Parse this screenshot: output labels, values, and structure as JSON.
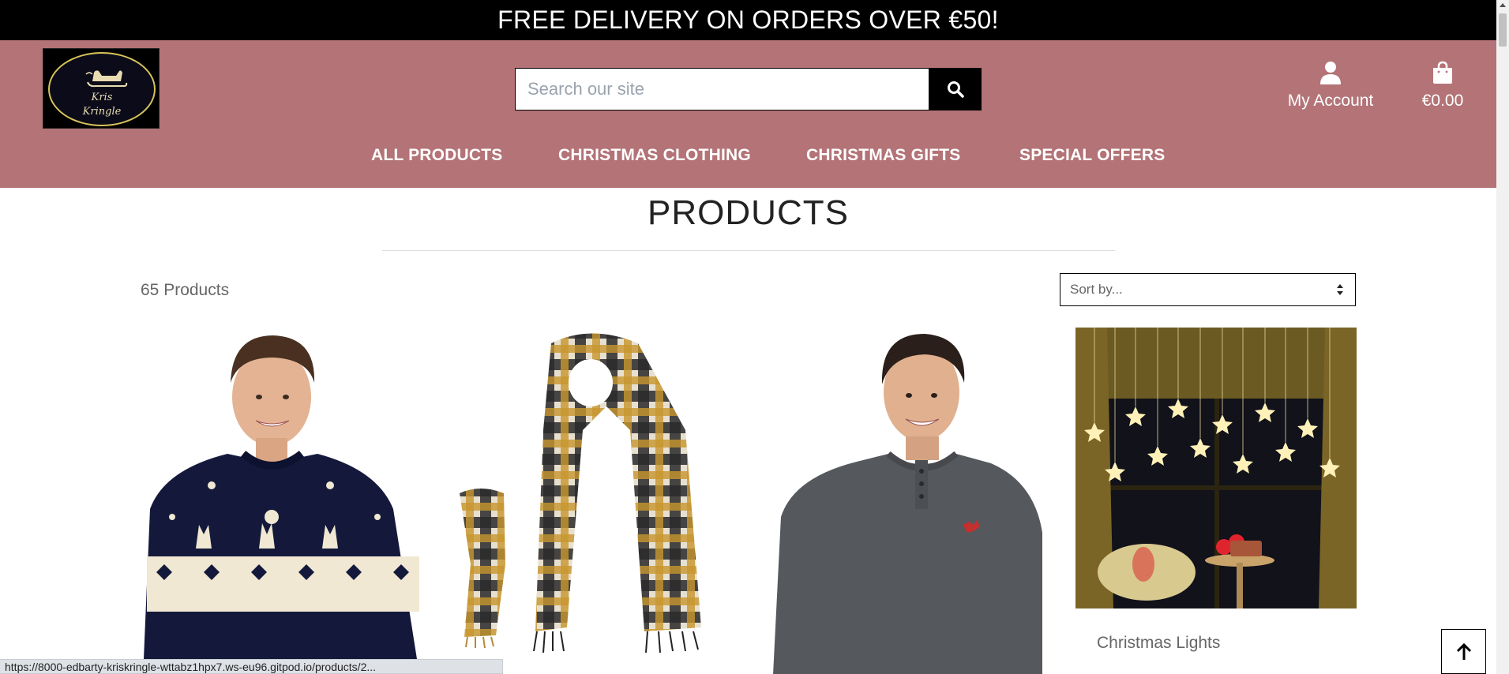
{
  "banner": {
    "text": "FREE DELIVERY ON ORDERS OVER €50!"
  },
  "brand": {
    "logo_line1": "Kris",
    "logo_line2": "Kringle"
  },
  "search": {
    "placeholder": "Search our site",
    "icon": "search-icon"
  },
  "account": {
    "label": "My Account",
    "icon": "user-icon"
  },
  "bag": {
    "total": "€0.00",
    "icon": "shopping-bag-icon"
  },
  "nav": {
    "items": [
      {
        "label": "ALL PRODUCTS"
      },
      {
        "label": "CHRISTMAS CLOTHING"
      },
      {
        "label": "CHRISTMAS GIFTS"
      },
      {
        "label": "SPECIAL OFFERS"
      }
    ]
  },
  "main": {
    "title": "PRODUCTS",
    "count_label": "65 Products",
    "sort": {
      "selected": "Sort by..."
    }
  },
  "products": [
    {
      "image": "reindeer-christmas-jumper"
    },
    {
      "image": "tartan-scarf"
    },
    {
      "image": "grey-henley-shirt"
    },
    {
      "image": "christmas-star-curtain-lights",
      "name": "Christmas Lights"
    }
  ],
  "status_bar": {
    "url": "https://8000-edbarty-kriskringle-wttabz1hpx7.ws-eu96.gitpod.io/products/2..."
  },
  "back_to_top": {
    "icon": "arrow-up-icon"
  },
  "colors": {
    "header_bg": "#b37377",
    "banner_bg": "#000000",
    "accent": "#000000"
  }
}
